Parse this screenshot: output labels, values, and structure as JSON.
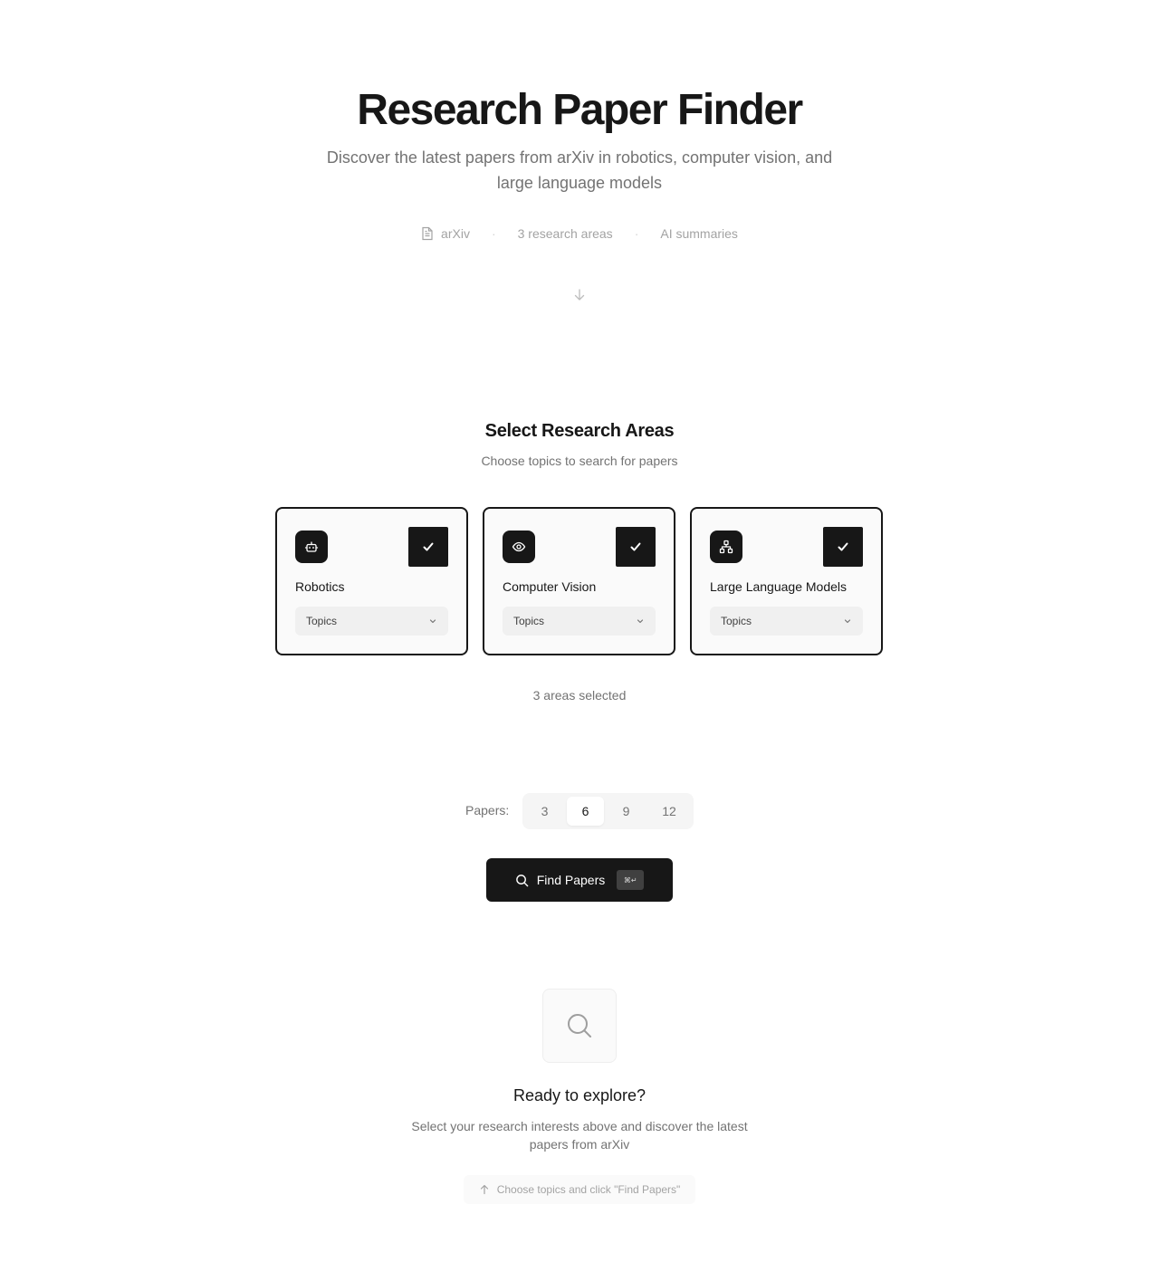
{
  "hero": {
    "title": "Research Paper Finder",
    "subtitle": "Discover the latest papers from arXiv in robotics, computer vision, and large language models",
    "meta": [
      {
        "label": "arXiv",
        "icon": "document-icon"
      },
      {
        "label": "3 research areas"
      },
      {
        "label": "AI summaries"
      }
    ],
    "meta_separator": "·"
  },
  "areas_section": {
    "title": "Select Research Areas",
    "subtitle": "Choose topics to search for papers",
    "cards": [
      {
        "label": "Robotics",
        "icon": "robot-icon",
        "selected": true,
        "select_label": "Topics"
      },
      {
        "label": "Computer Vision",
        "icon": "eye-icon",
        "selected": true,
        "select_label": "Topics"
      },
      {
        "label": "Large Language Models",
        "icon": "network-icon",
        "selected": true,
        "select_label": "Topics"
      }
    ],
    "selected_count_text": "3 areas selected"
  },
  "papers": {
    "label": "Papers:",
    "options": [
      "3",
      "6",
      "9",
      "12"
    ],
    "selected": "6"
  },
  "find_button": {
    "label": "Find Papers",
    "shortcut": "⌘↵"
  },
  "empty_state": {
    "title": "Ready to explore?",
    "description": "Select your research interests above and discover the latest papers from arXiv",
    "hint": "Choose topics and click \"Find Papers\""
  },
  "colors": {
    "primary": "#171717",
    "muted": "#737373",
    "background": "#ffffff"
  }
}
